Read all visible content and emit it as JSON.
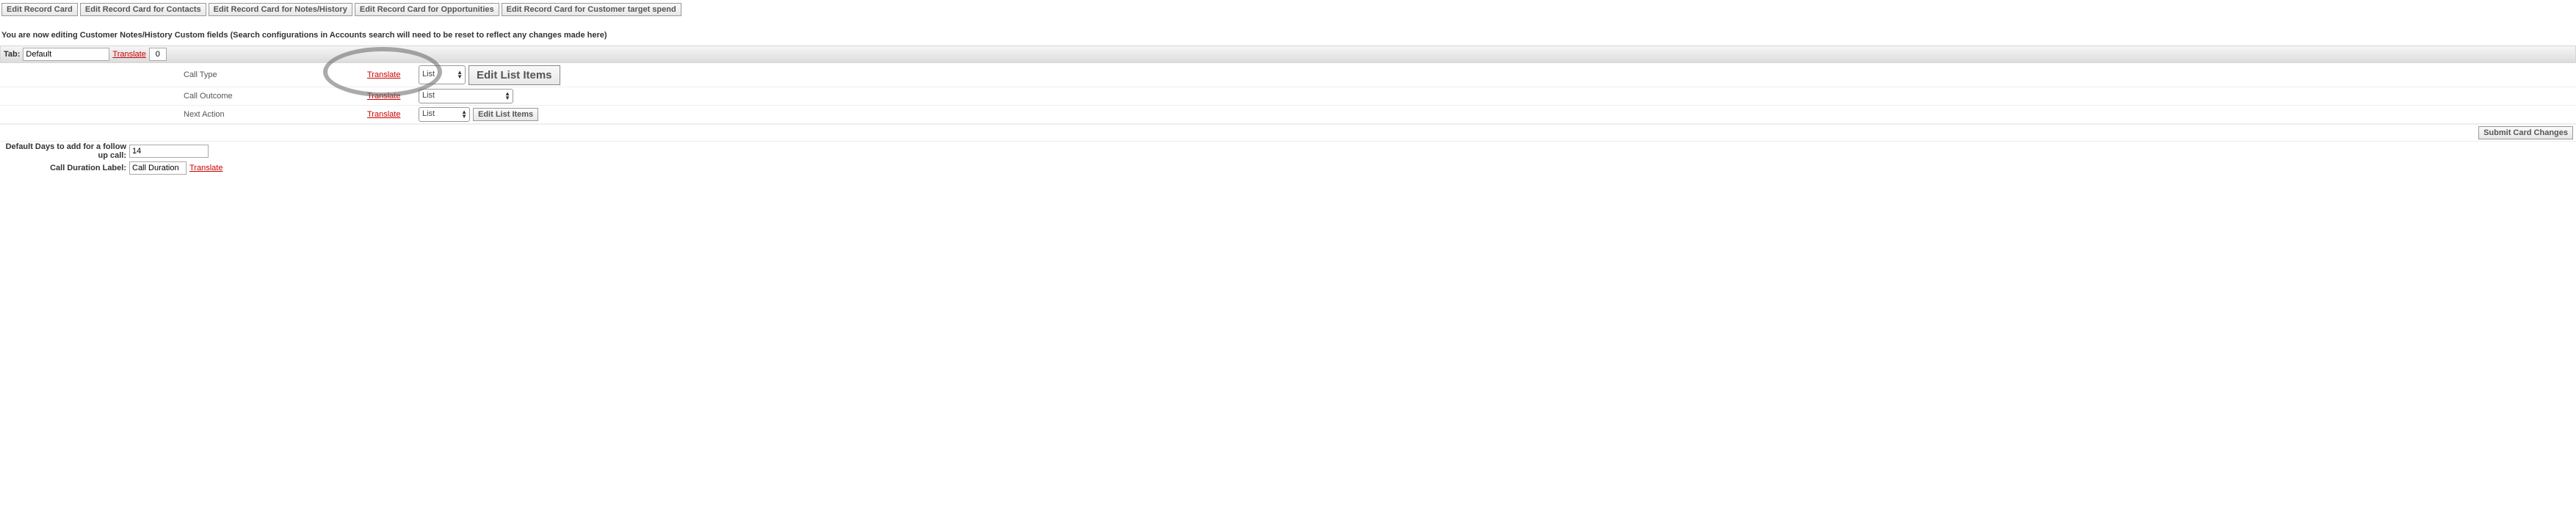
{
  "top_buttons": {
    "edit_record_card": "Edit Record Card",
    "edit_contacts": "Edit Record Card for Contacts",
    "edit_notes": "Edit Record Card for Notes/History",
    "edit_opportunities": "Edit Record Card for Opportunities",
    "edit_spend": "Edit Record Card for Customer target spend"
  },
  "instruction_text": "You are now editing Customer Notes/History Custom fields (Search configurations in Accounts search will need to be reset to reflect any changes made here)",
  "tab_bar": {
    "label": "Tab:",
    "tab_name": "Default",
    "translate": "Translate",
    "order": "0"
  },
  "fields": [
    {
      "label": "Call Type",
      "translate": "Translate",
      "type": "List",
      "button": "Edit List Items",
      "big": true
    },
    {
      "label": "Call Outcome",
      "translate": "Translate",
      "type": "List",
      "button": "",
      "big": false
    },
    {
      "label": "Next Action",
      "translate": "Translate",
      "type": "List",
      "button": "Edit List Items",
      "big": false
    }
  ],
  "submit": {
    "label": "Submit Card Changes"
  },
  "footer": {
    "default_days_label": "Default Days to add for a follow up call:",
    "default_days_value": "14",
    "call_duration_label_label": "Call Duration Label:",
    "call_duration_value": "Call Duration",
    "translate": "Translate"
  }
}
